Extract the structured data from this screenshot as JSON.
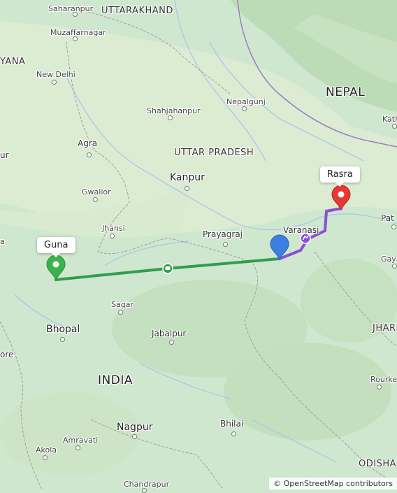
{
  "map": {
    "countries": {
      "nepal": "NEPAL",
      "india": "INDIA"
    },
    "states": {
      "uttarakhand": "UTTARAKHAND",
      "uttar_pradesh": "UTTAR PRADESH",
      "haryana_partial": "YANA",
      "jharkhand_partial": "JHARI",
      "odisha": "ODISHA"
    },
    "cities": {
      "saharanpur": "Saharanpur",
      "muzaffarnagar": "Muzaffarnagar",
      "new_delhi": "New Delhi",
      "nepalgunj": "Nepalgunj",
      "shahjahanpur": "Shahjahanpur",
      "agra": "Agra",
      "kanpur": "Kanpur",
      "gwalior": "Gwalior",
      "jhansi": "Jhansi",
      "prayagraj": "Prayagraj",
      "varanasi": "Varanasi",
      "sagar": "Sagar",
      "bhopal": "Bhopal",
      "jabalpur": "Jabalpur",
      "nagpur": "Nagpur",
      "bhilai": "Bhilai",
      "amravati": "Amravati",
      "akola": "Akola",
      "chandrapur": "Chandrapur",
      "rourkela": "Rourkela",
      "kath_partial": "Kath",
      "patna_partial": "Pat",
      "gaya_partial": "Gaya",
      "edge_ur": "ur",
      "edge_ore": "ore",
      "edge_a": "a"
    },
    "markers": {
      "start": {
        "label": "Guna",
        "color": "#3cb34a"
      },
      "end": {
        "label": "Rasra",
        "color": "#e53935"
      },
      "waypoint": {
        "color": "#3d7fe0"
      }
    },
    "route_colors": {
      "segment_1": "#2f9e4f",
      "segment_2": "#8a4fd8"
    },
    "attribution": "© OpenStreetMap contributors"
  }
}
